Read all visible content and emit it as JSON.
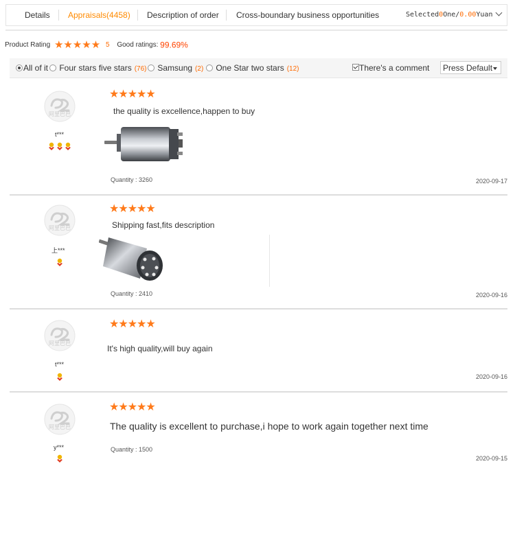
{
  "tabs": [
    {
      "label": "Details"
    },
    {
      "label": "Appraisals(4458)"
    },
    {
      "label": "Description of order"
    },
    {
      "label": "Cross-boundary business opportunities"
    }
  ],
  "selected": {
    "prefix": "Selected",
    "count": "0",
    "mid": "One/",
    "amount": "0.00",
    "suffix": "Yuan"
  },
  "rating": {
    "label": "Product Rating",
    "stars": 5,
    "score": "5",
    "good_label": "Good ratings:",
    "good_value": "99.69%"
  },
  "filters": {
    "all": "All of it",
    "four_five": {
      "label": "Four stars five stars",
      "count": "(76)"
    },
    "samsung": {
      "label": "Samsung",
      "count": "(2)"
    },
    "one_two": {
      "label": "One Star two stars",
      "count": "(12)"
    },
    "comment": {
      "label": "There's a comment",
      "checked": true
    },
    "sort": "Press Default"
  },
  "reviews": [
    {
      "user": "t***",
      "medals": 3,
      "stars": 5,
      "text": "the quality is excellence,happen to buy",
      "quantity": "Quantity : 3260",
      "date": "2020-09-17",
      "image": "motor-side-view"
    },
    {
      "user": "上***",
      "medals": 1,
      "stars": 5,
      "text": "Shipping fast,fits description",
      "quantity": "Quantity : 2410",
      "date": "2020-09-16",
      "image": "motor-end-view"
    },
    {
      "user": "t***",
      "medals": 1,
      "stars": 5,
      "text": "It's high quality,will buy again",
      "quantity": "",
      "date": "2020-09-16"
    },
    {
      "user": "y***",
      "medals": 1,
      "stars": 5,
      "text": "The quality is excellent to purchase,i hope to work again together next time",
      "quantity": "Quantity : 1500",
      "date": "2020-09-15"
    }
  ],
  "colors": {
    "accent": "#ff8a00",
    "price": "#ff4400",
    "star": "#ff7a1a"
  }
}
